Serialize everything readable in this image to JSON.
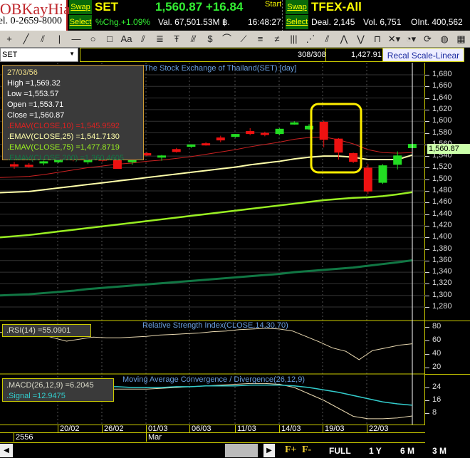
{
  "header": {
    "logo_line1": "UOBKayHian",
    "logo_line2": "Tel. 0-2659-8000",
    "swap_label": "Swap",
    "select_label": "Select",
    "set": {
      "symbol": "SET",
      "price_change": "1,560.87 +16.84",
      "start_label": "Start",
      "pct_change": "%Chg.+1.09%",
      "value": "Val. 67,501.53M ฿.",
      "time": "16:48:27"
    },
    "tfex": {
      "symbol": "TFEX-All",
      "deal": "Deal. 2,145",
      "vol": "Vol. 6,751",
      "oint": "OInt. 400,562"
    }
  },
  "toolbar": {
    "icons": [
      "crosshair-icon",
      "line-icon",
      "parallel-line-icon",
      "vertical-line-icon",
      "horizontal-line-icon",
      "circle-icon",
      "rectangle-icon",
      "text-icon",
      "channel-icon",
      "fibonacci-icon",
      "fibonacci-time-icon",
      "andrews-pitchfork-icon",
      "speed-line-icon",
      "fibonacci-arc-icon",
      "fan-icon",
      "retracement-icon",
      "gann-icon",
      "time-zone-icon",
      "gann-fan-icon",
      "cycle-icon",
      "elliott-wave-icon",
      "abc-wave-icon",
      "magnet-icon",
      "delete-icon",
      "clock-icon",
      "refresh-icon",
      "palette-icon",
      "calendar-icon"
    ]
  },
  "symbol_bar": {
    "symbol": "SET",
    "count": "308/308",
    "cursor_value": "1,427.91",
    "recal_label": "Recal Scale-Linear"
  },
  "main_chart": {
    "title": "The Stock Exchange of Thailand(SET) [day]",
    "last_price_label": "1,560.87",
    "y_ticks": [
      "1,680",
      "1,660",
      "1,640",
      "1,620",
      "1,600",
      "1,580",
      "1,560",
      "1,540",
      "1,520",
      "1,500",
      "1,480",
      "1,460",
      "1,440",
      "1,420",
      "1,400",
      "1,380",
      "1,360",
      "1,340",
      "1,320",
      "1,300",
      "1,280"
    ],
    "y_range": [
      1280,
      1680
    ],
    "info": {
      "date": "27/03/56",
      "high": "High  =1,569.32",
      "low": "Low  =1,553.57",
      "open": "Open  =1,553.71",
      "close": "Close  =1,560.87",
      "ema10": ".EMAV(CLOSE,10)   =1,545.9592",
      "ema25": ".EMAV(CLOSE,25)   =1,541.7130",
      "ema75": ".EMAV(CLOSE,75)   =1,477.8719",
      "ema200": ".EMAV(CLOSE,200)   =1,360.4605"
    },
    "colors": {
      "up": "#22dd22",
      "down": "#ee1111",
      "ema10": "#cc2222",
      "ema25": "#ffffaa",
      "ema75": "#99ee22",
      "ema200": "#117744",
      "highlight": "#ffee00"
    },
    "candles_ohlc": [
      [
        1526,
        1530,
        1518,
        1522
      ],
      [
        1525,
        1528,
        1520,
        1522
      ],
      [
        1528,
        1532,
        1524,
        1531
      ],
      [
        1532,
        1535,
        1528,
        1533
      ],
      [
        1537,
        1540,
        1531,
        1533
      ],
      [
        1530,
        1535,
        1526,
        1533
      ],
      [
        1536,
        1538,
        1530,
        1532
      ],
      [
        1536,
        1538,
        1518,
        1518
      ],
      [
        1531,
        1534,
        1525,
        1533
      ],
      [
        1545,
        1547,
        1540,
        1541
      ],
      [
        1538,
        1542,
        1532,
        1541
      ],
      [
        1552,
        1554,
        1546,
        1547
      ],
      [
        1556,
        1560,
        1554,
        1560
      ],
      [
        1562,
        1564,
        1558,
        1559
      ],
      [
        1572,
        1575,
        1564,
        1567
      ],
      [
        1573,
        1578,
        1572,
        1578
      ],
      [
        1583,
        1588,
        1576,
        1578
      ],
      [
        1580,
        1582,
        1574,
        1577
      ],
      [
        1578,
        1588,
        1576,
        1587
      ],
      [
        1596,
        1600,
        1594,
        1598
      ],
      [
        1586,
        1595,
        1585,
        1592
      ],
      [
        1599,
        1601,
        1555,
        1568
      ],
      [
        1570,
        1571,
        1534,
        1546
      ],
      [
        1545,
        1546,
        1528,
        1530
      ],
      [
        1520,
        1526,
        1475,
        1479
      ],
      [
        1494,
        1526,
        1492,
        1524
      ],
      [
        1525,
        1548,
        1517,
        1541
      ],
      [
        1553.71,
        1569.32,
        1553.57,
        1560.87
      ]
    ],
    "ema10": [
      1503,
      1505,
      1508,
      1512,
      1516,
      1520,
      1523,
      1526,
      1528,
      1531,
      1533,
      1536,
      1539,
      1543,
      1547,
      1551,
      1556,
      1560,
      1564,
      1569,
      1572,
      1573,
      1568,
      1561,
      1551,
      1546,
      1545,
      1545.96
    ],
    "ema25": [
      1477,
      1479,
      1482,
      1485,
      1488,
      1491,
      1494,
      1497,
      1500,
      1503,
      1506,
      1509,
      1512,
      1515,
      1518,
      1521,
      1525,
      1528,
      1531,
      1535,
      1538,
      1540,
      1540,
      1538,
      1534,
      1534,
      1534,
      1541.71
    ],
    "ema75": [
      1400,
      1404,
      1407,
      1410,
      1413,
      1416,
      1419,
      1422,
      1425,
      1428,
      1431,
      1434,
      1437,
      1440,
      1443,
      1446,
      1449,
      1452,
      1455,
      1458,
      1461,
      1464,
      1466,
      1468,
      1469,
      1471,
      1474,
      1477.87
    ],
    "ema200": [
      1300,
      1302,
      1304,
      1306,
      1308,
      1311,
      1313,
      1315,
      1317,
      1319,
      1321,
      1323,
      1325,
      1327,
      1329,
      1331,
      1333,
      1335,
      1337,
      1340,
      1342,
      1344,
      1346,
      1348,
      1351,
      1354,
      1357,
      1360.46
    ]
  },
  "rsi": {
    "title": "Relative Strength Index(CLOSE,14,30,70)",
    "label": ".RSI(14)   =55.0901",
    "y_ticks": [
      "80",
      "60",
      "40",
      "20"
    ],
    "y_range": [
      10,
      85
    ],
    "values": [
      72,
      71,
      70,
      69.5,
      64,
      59,
      62,
      65,
      64,
      64,
      65,
      66,
      68,
      69,
      70,
      71,
      73,
      74,
      76,
      77,
      78,
      77,
      74,
      66,
      58,
      49,
      44,
      31.6,
      45,
      49,
      53,
      55.09
    ],
    "color": "#e8d8b0"
  },
  "macd": {
    "title": "Moving Average Convergence / Divergence(26,12,9)",
    "macd_label": ".MACD(26,12,9)   =6.2045",
    "signal_label": ".Signal   =12.9475",
    "y_ticks": [
      "24",
      "16",
      "8"
    ],
    "y_range": [
      2,
      30
    ],
    "macd": [
      24,
      24,
      24,
      24,
      24,
      23.5,
      23,
      23,
      23,
      23,
      23.5,
      24,
      24.5,
      25,
      25.5,
      26,
      26.5,
      26.5,
      26,
      24,
      20,
      16,
      11,
      6,
      4.5,
      4.5,
      5,
      6.2
    ],
    "signal": [
      26,
      26,
      25.5,
      25.5,
      25,
      25,
      24.5,
      24.5,
      24,
      24,
      24,
      24.5,
      24.5,
      25,
      25,
      25,
      25.5,
      25.5,
      25.5,
      25,
      24,
      22.5,
      21,
      19,
      17,
      15,
      13.8,
      12.95
    ],
    "macd_color": "#e8d8b0",
    "signal_color": "#33cccc"
  },
  "date_axis": {
    "dates": [
      "20/02",
      "26/02",
      "01/03",
      "06/03",
      "11/03",
      "14/03",
      "19/03",
      "22/03"
    ],
    "year": "2556",
    "month": "Mar"
  },
  "bottom": {
    "zoom_in": "F+",
    "zoom_out": "F-",
    "ranges": [
      "FULL",
      "1 Y",
      "6 M",
      "3 M"
    ]
  }
}
